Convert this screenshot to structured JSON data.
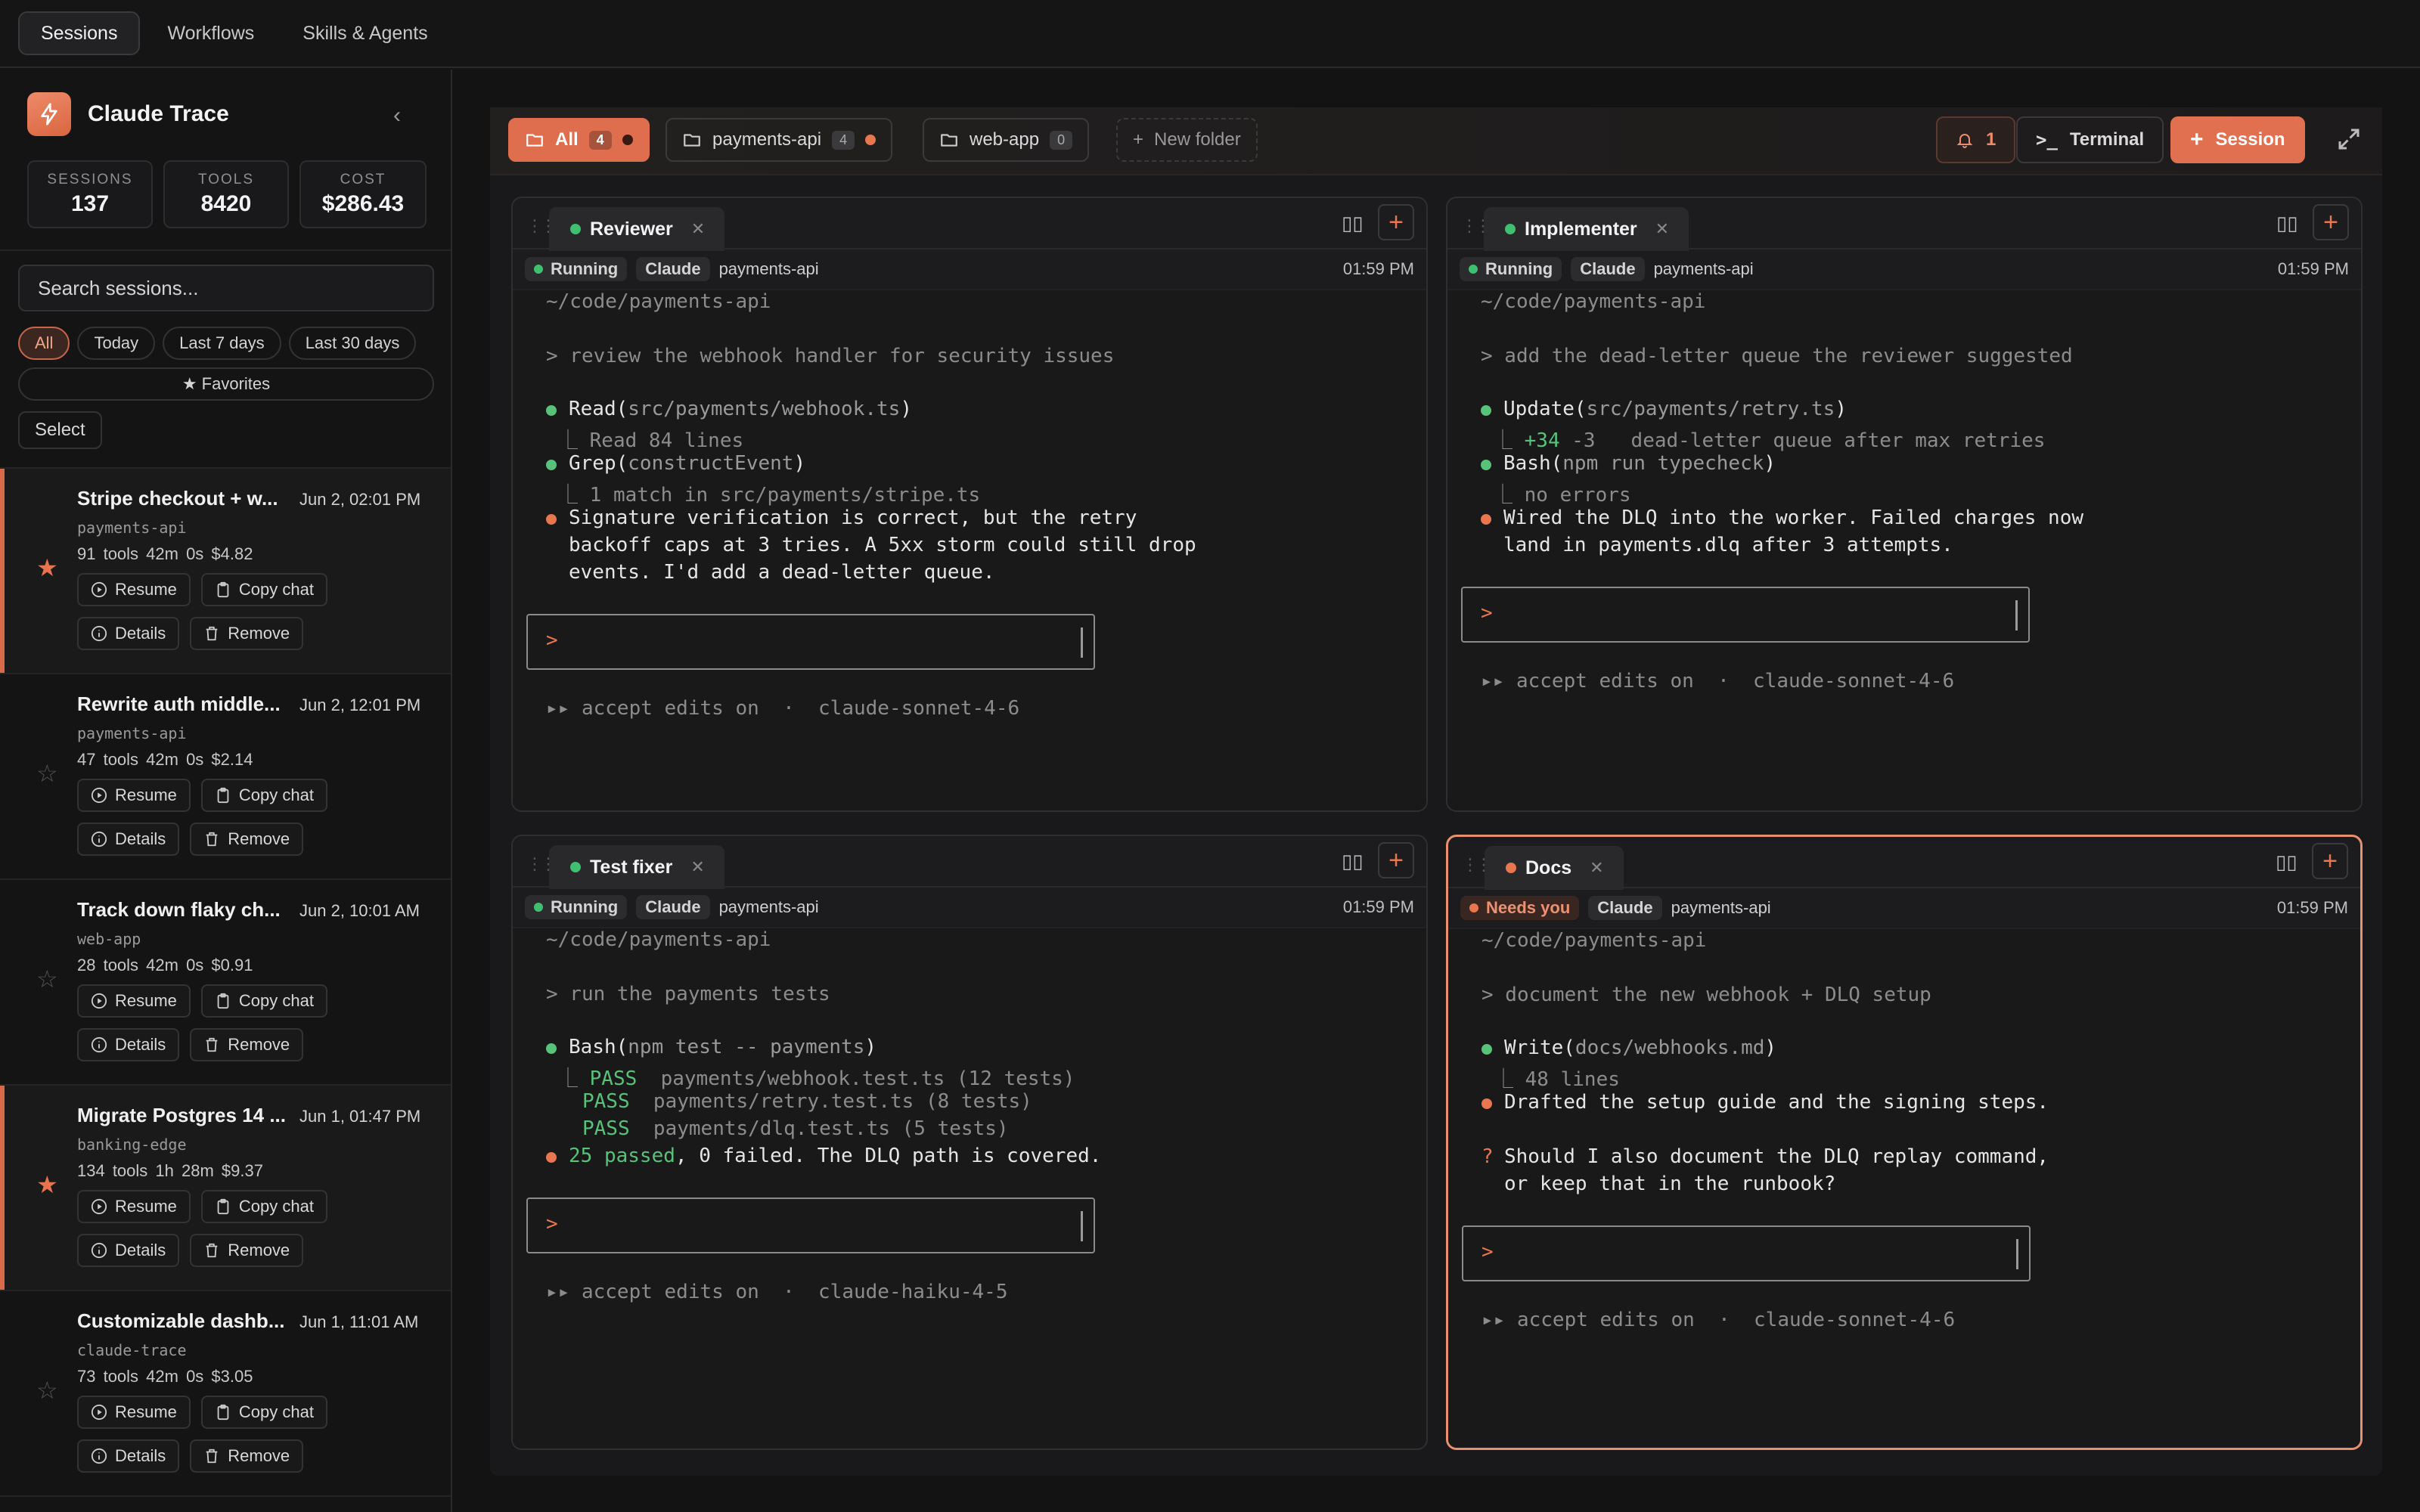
{
  "nav": {
    "tabs": [
      "Sessions",
      "Workflows",
      "Skills & Agents"
    ]
  },
  "sidebar": {
    "title": "Claude Trace",
    "stats": [
      {
        "label": "SESSIONS",
        "value": "137"
      },
      {
        "label": "TOOLS",
        "value": "8420"
      },
      {
        "label": "COST",
        "value": "$286.43"
      }
    ],
    "search_placeholder": "Search sessions...",
    "filters": [
      "All",
      "Today",
      "Last 7 days",
      "Last 30 days"
    ],
    "favorites": "★ Favorites",
    "select": "Select",
    "actions": {
      "resume": "Resume",
      "copy": "Copy chat",
      "details": "Details",
      "remove": "Remove"
    },
    "sessions": [
      {
        "title": "Stripe checkout + w...",
        "date": "Jun 2, 02:01 PM",
        "project": "payments-api",
        "meta": "91 tools  42m 0s  $4.82",
        "starred": true
      },
      {
        "title": "Rewrite auth middle...",
        "date": "Jun 2, 12:01 PM",
        "project": "payments-api",
        "meta": "47 tools  42m 0s  $2.14",
        "starred": false
      },
      {
        "title": "Track down flaky ch...",
        "date": "Jun 2, 10:01 AM",
        "project": "web-app",
        "meta": "28 tools  42m 0s  $0.91",
        "starred": false
      },
      {
        "title": "Migrate Postgres 14 ...",
        "date": "Jun 1, 01:47 PM",
        "project": "banking-edge",
        "meta": "134 tools  1h 28m  $9.37",
        "starred": true
      },
      {
        "title": "Customizable dashb...",
        "date": "Jun 1, 11:01 AM",
        "project": "claude-trace",
        "meta": "73 tools  42m 0s  $3.05",
        "starred": false
      }
    ]
  },
  "toolbar": {
    "folders": [
      {
        "label": "All",
        "count": "4"
      },
      {
        "label": "payments-api",
        "count": "4"
      },
      {
        "label": "web-app",
        "count": "0"
      }
    ],
    "new_folder": "New folder",
    "notif_count": "1",
    "terminal": "Terminal",
    "session": "Session"
  },
  "panes": [
    {
      "name": "Reviewer",
      "status": "Running",
      "agent": "Claude",
      "project": "payments-api",
      "time": "01:59 PM",
      "cwd": "~/code/payments-api",
      "prompt": "> review the webhook handler for security issues",
      "l1a": "Read(",
      "l1b": "src/payments/webhook.ts",
      "l1c": ")",
      "l2": "⎿ Read 84 lines",
      "l3a": "Grep(",
      "l3b": "constructEvent",
      "l3c": ")",
      "l4": "⎿ 1 match in src/payments/stripe.ts",
      "l5": "Signature verification is correct, but the retry",
      "l6": "backoff caps at 3 tries. A 5xx storm could still drop",
      "l7": "events. I'd add a dead-letter queue.",
      "input_prompt": ">",
      "footer": "▸▸ accept edits on  ·  claude-sonnet-4-6"
    },
    {
      "name": "Implementer",
      "status": "Running",
      "agent": "Claude",
      "project": "payments-api",
      "time": "01:59 PM",
      "cwd": "~/code/payments-api",
      "prompt": "> add the dead-letter queue the reviewer suggested",
      "l1a": "Update(",
      "l1b": "src/payments/retry.ts",
      "l1c": ")",
      "l2a": "⎿ ",
      "l2b": "+34",
      "l2c": " -3   dead-letter queue after max retries",
      "l3a": "Bash(",
      "l3b": "npm run typecheck",
      "l3c": ")",
      "l4": "⎿ no errors",
      "l5": "Wired the DLQ into the worker. Failed charges now",
      "l6": "land in payments.dlq after 3 attempts.",
      "input_prompt": ">",
      "footer": "▸▸ accept edits on  ·  claude-sonnet-4-6"
    },
    {
      "name": "Test fixer",
      "status": "Running",
      "agent": "Claude",
      "project": "payments-api",
      "time": "01:59 PM",
      "cwd": "~/code/payments-api",
      "prompt": "> run the payments tests",
      "l1a": "Bash(",
      "l1b": "npm test -- payments",
      "l1c": ")",
      "t1a": "⎿ ",
      "t1b": "PASS",
      "t1c": "  payments/webhook.test.ts (12 tests)",
      "t2b": "PASS",
      "t2c": "  payments/retry.test.ts (8 tests)",
      "t3b": "PASS",
      "t3c": "  payments/dlq.test.ts (5 tests)",
      "l5a": "25 passed",
      "l5b": ", 0 failed. The DLQ path is covered.",
      "input_prompt": ">",
      "footer": "▸▸ accept edits on  ·  claude-haiku-4-5"
    },
    {
      "name": "Docs",
      "status": "Needs you",
      "agent": "Claude",
      "project": "payments-api",
      "time": "01:59 PM",
      "cwd": "~/code/payments-api",
      "prompt": "> document the new webhook + DLQ setup",
      "l1a": "Write(",
      "l1b": "docs/webhooks.md",
      "l1c": ")",
      "l2": "⎿ 48 lines",
      "l3": "Drafted the setup guide and the signing steps.",
      "q_mark": "?",
      "q1": "Should I also document the DLQ replay command,",
      "q2": "or keep that in the runbook?",
      "input_prompt": ">",
      "footer": "▸▸ accept edits on  ·  claude-sonnet-4-6"
    }
  ],
  "colors": {
    "accent": "#e0704f",
    "running": "#3fbf6f",
    "needs": "#e8764f",
    "pass": "#58c27a"
  }
}
